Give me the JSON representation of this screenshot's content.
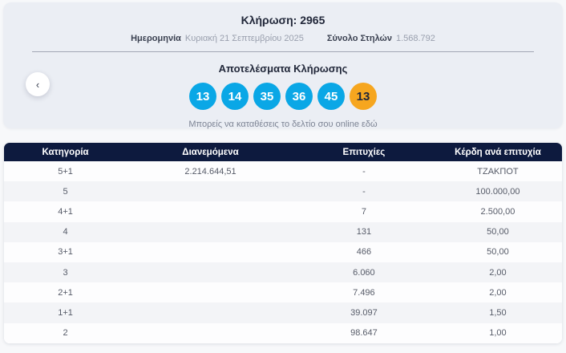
{
  "colors": {
    "ball_blue": "#0aa7e6",
    "ball_orange": "#f6a61f",
    "header_navy": "#0d1a3e"
  },
  "draw_header": {
    "title": "Κλήρωση: 2965",
    "date_label": "Ημερομηνία",
    "date_value": "Κυριακή 21 Σεπτεμβρίου 2025",
    "columns_label": "Σύνολο Στηλών",
    "columns_value": "1.568.792"
  },
  "results": {
    "title": "Αποτελέσματα Κλήρωσης",
    "numbers": [
      "13",
      "14",
      "35",
      "36",
      "45"
    ],
    "joker": "13",
    "deposit_link": "Μπορείς να καταθέσεις το δελτίο σου online εδώ",
    "prev_arrow": "‹"
  },
  "table": {
    "headers": [
      "Κατηγορία",
      "Διανεμόμενα",
      "Επιτυχίες",
      "Κέρδη ανά επιτυχία"
    ],
    "rows": [
      [
        "5+1",
        "2.214.644,51",
        "-",
        "ΤΖΑΚΠΟΤ"
      ],
      [
        "5",
        "",
        "-",
        "100.000,00"
      ],
      [
        "4+1",
        "",
        "7",
        "2.500,00"
      ],
      [
        "4",
        "",
        "131",
        "50,00"
      ],
      [
        "3+1",
        "",
        "466",
        "50,00"
      ],
      [
        "3",
        "",
        "6.060",
        "2,00"
      ],
      [
        "2+1",
        "",
        "7.496",
        "2,00"
      ],
      [
        "1+1",
        "",
        "39.097",
        "1,50"
      ],
      [
        "2",
        "",
        "98.647",
        "1,00"
      ]
    ]
  }
}
